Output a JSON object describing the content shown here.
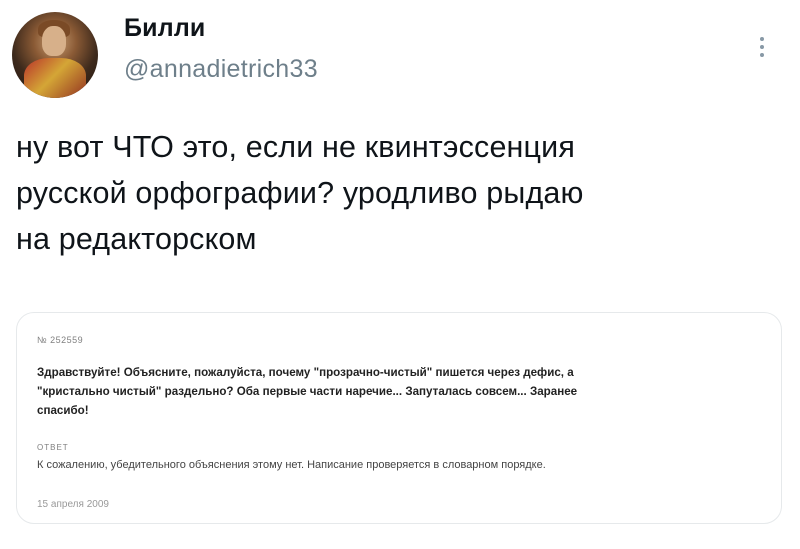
{
  "author": {
    "name": "Билли",
    "handle": "@annadietrich33",
    "avatar_icon": "avatar-photo"
  },
  "menu_icon": "vertical-ellipsis-icon",
  "tweet": {
    "lines": [
      "ну вот ЧТО это, если не квинтэссенция",
      "русской орфографии? уродливо рыдаю",
      "на редакторском"
    ]
  },
  "card": {
    "number": "№ 252559",
    "question_lines": [
      "Здравствуйте! Объясните, пожалуйста, почему \"прозрачно-чистый\" пишется через дефис, а",
      "\"кристально чистый\" раздельно? Оба первые части наречие... Запуталась совсем... Заранее",
      "спасибо!"
    ],
    "answer_label": "ОТВЕТ",
    "answer": "К сожалению, убедительного объяснения этому нет. Написание проверяется в словарном порядке.",
    "date": "15 апреля 2009"
  }
}
